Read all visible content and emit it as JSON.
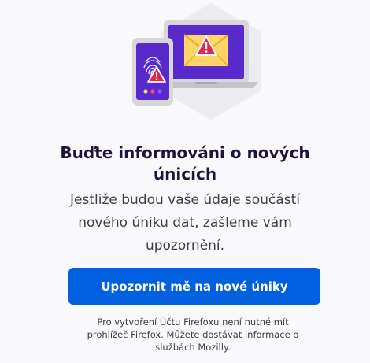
{
  "icons": {
    "illustration": "breach-alert-devices-illustration",
    "fingerprint": "fingerprint-icon",
    "warning": "warning-icon",
    "mail": "envelope-icon"
  },
  "colors": {
    "accent": "#0060df",
    "device_screen": "#592acb",
    "warning_red": "#e22850",
    "envelope": "#ffd567",
    "hexagon_bg": "#ececf1",
    "title": "#20123a"
  },
  "onboarding": {
    "title": "Buďte informováni o nových únicích",
    "description": "Jestliže budou vaše údaje součástí nového úniku dat, zašleme vám upozornění.",
    "cta_label": "Upozornit mě na nové úniky",
    "note": "Pro vytvoření Účtu Firefoxu není nutné mít prohlížeč Firefox. Můžete dostávat informace o službách Mozilly."
  }
}
